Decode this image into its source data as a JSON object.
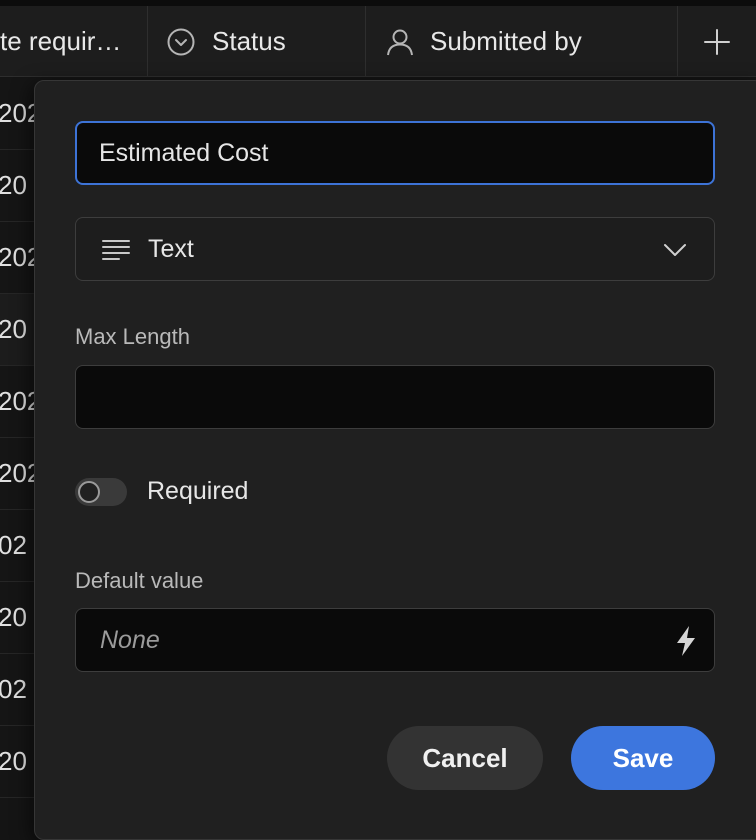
{
  "table": {
    "columns": [
      {
        "label": "te requir…",
        "icon": ""
      },
      {
        "label": "Status",
        "icon": "status-circle-icon"
      },
      {
        "label": "Submitted by",
        "icon": "user-icon"
      }
    ],
    "add_column_icon": "plus-icon",
    "row_fragments": [
      "202",
      "20",
      "202",
      "20",
      "202",
      "202",
      "02",
      "20",
      "02",
      "20"
    ]
  },
  "field_editor": {
    "name_value": "Estimated Cost",
    "type": {
      "label": "Text",
      "icon": "text-lines-icon",
      "chevron_icon": "chevron-down-icon"
    },
    "max_length": {
      "label": "Max Length",
      "value": ""
    },
    "required": {
      "label": "Required",
      "enabled": false
    },
    "default_value": {
      "label": "Default value",
      "placeholder": "None",
      "icon": "lightning-bolt-icon"
    },
    "cancel_label": "Cancel",
    "save_label": "Save"
  },
  "colors": {
    "accent": "#3d76de",
    "focus_border": "#3d73d6",
    "panel_bg": "#202020"
  }
}
